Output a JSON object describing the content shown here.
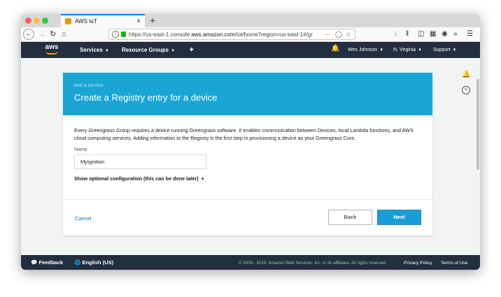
{
  "browser": {
    "tab_title": "AWS IoT",
    "tab_close": "×",
    "new_tab": "+",
    "url_prefix": "https://us-east-1.console.",
    "url_host": "aws.amazon.com",
    "url_path": "/iot/home?region=us-east-1#/gr",
    "icons": [
      "back-icon",
      "forward-icon",
      "reload-icon",
      "home-icon",
      "info-icon",
      "lock-icon",
      "page-actions-icon",
      "pocket-icon",
      "bookmark-star-icon",
      "download-icon",
      "library-icon",
      "sidebar-icon",
      "reader-icon",
      "account-icon",
      "overflow-icon",
      "menu-icon"
    ]
  },
  "aws_header": {
    "logo": "aws",
    "services": "Services",
    "resource_groups": "Resource Groups",
    "user": "Wes Johnson",
    "region": "N. Virginia",
    "support": "Support"
  },
  "card": {
    "eyebrow": "ADD A DEVICE",
    "title": "Create a Registry entry for a device",
    "description": "Every Greengrass Group requires a device running Greengrass software. It enables communication between Devices, local Lambda functions, and AWS cloud computing services. Adding information to the Registry is the first step in provisioning a device as your Greengrass Core.",
    "name_label": "Name",
    "name_value": "MyIgnition",
    "optional_config": "Show optional configuration (this can be done later)",
    "cancel": "Cancel",
    "back": "Back",
    "next": "Next"
  },
  "footer": {
    "feedback": "Feedback",
    "language": "English (US)",
    "copyright": "© 2008 - 2019, Amazon Web Services, Inc. or its affiliates. All rights reserved.",
    "privacy": "Privacy Policy",
    "terms": "Terms of Use"
  },
  "colors": {
    "header_bg": "#232f3e",
    "accent_orange": "#ff9900",
    "card_header": "#1aa6d4",
    "primary_button": "#1a9dd6",
    "link": "#0073bb"
  }
}
